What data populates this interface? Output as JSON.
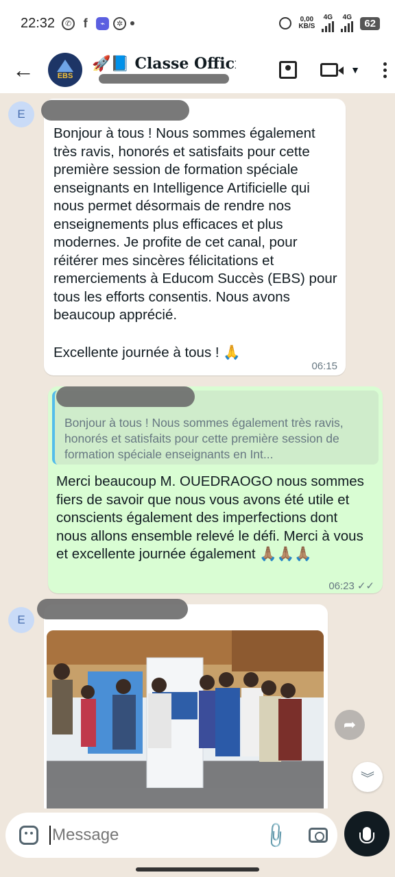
{
  "status_bar": {
    "time": "22:32",
    "net_speed_top": "0,00",
    "net_speed_bottom": "KB/S",
    "network_1": "4G",
    "network_2": "4G",
    "battery": "62"
  },
  "header": {
    "title": "🚀📘 Classe Offici...",
    "avatar_text": "EBS"
  },
  "messages": [
    {
      "sender_initial": "E",
      "text": "Bonjour à tous ! Nous sommes également très ravis, honorés et satisfaits pour cette première session de formation spéciale enseignants en Intelligence Artificielle qui nous permet désormais de rendre nos enseignements plus efficaces et plus modernes. Je profite de cet canal, pour réitérer mes sincères félicitations et remerciements à Educom Succès (EBS) pour tous les efforts consentis. Nous avons beaucoup apprécié.",
      "text2": "Excellente journée à tous ! 🙏",
      "time": "06:15"
    },
    {
      "quoted_text": "Bonjour à tous ! Nous sommes également très ravis, honorés et satisfaits pour cette première session de formation spéciale enseignants en Int...",
      "text": "Merci beaucoup M. OUEDRAOGO nous sommes fiers de savoir que nous vous avons été utile et conscients également des imperfections dont nous allons ensemble relevé le défi. Merci à vous et excellente journée également 🙏🏽🙏🏽🙏🏽",
      "time": "06:23",
      "ticks": "✓✓"
    },
    {
      "sender_initial": "E",
      "type": "image"
    }
  ],
  "input": {
    "placeholder": "Message"
  },
  "icons": {
    "forward": "forward-icon",
    "scroll_down": "chevrons-down-icon"
  }
}
